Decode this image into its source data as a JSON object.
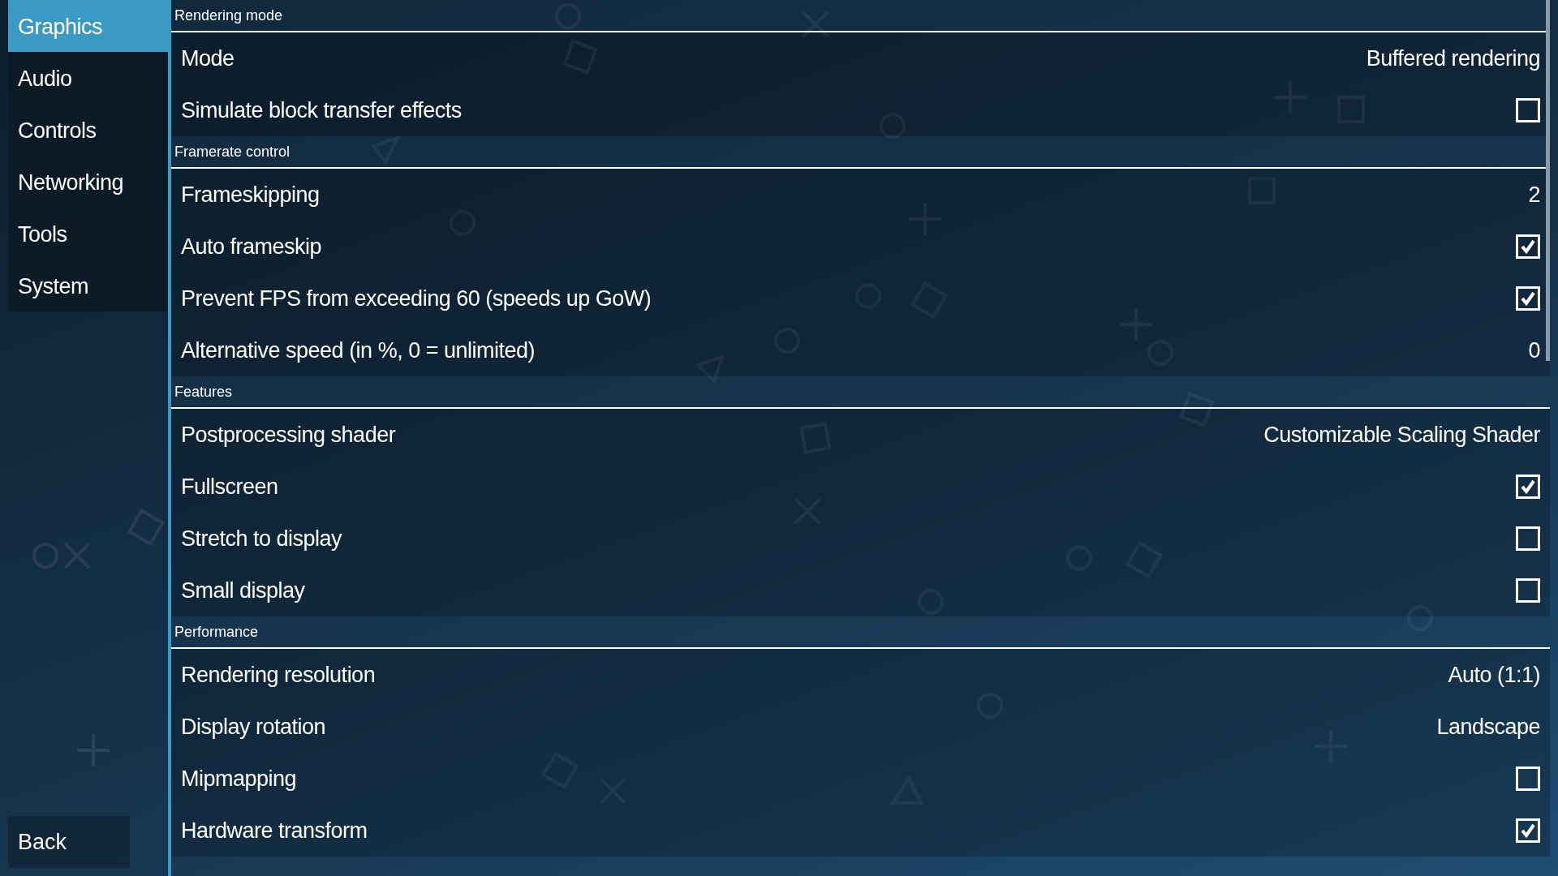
{
  "sidebar": {
    "items": [
      {
        "label": "Graphics",
        "selected": true
      },
      {
        "label": "Audio",
        "selected": false
      },
      {
        "label": "Controls",
        "selected": false
      },
      {
        "label": "Networking",
        "selected": false
      },
      {
        "label": "Tools",
        "selected": false
      },
      {
        "label": "System",
        "selected": false
      }
    ],
    "back_button": "Back"
  },
  "sections": [
    {
      "title": "Rendering mode",
      "rows": [
        {
          "kind": "value",
          "label": "Mode",
          "value": "Buffered rendering"
        },
        {
          "kind": "checkbox",
          "label": "Simulate block transfer effects",
          "checked": false
        }
      ]
    },
    {
      "title": "Framerate control",
      "rows": [
        {
          "kind": "value",
          "label": "Frameskipping",
          "value": "2"
        },
        {
          "kind": "checkbox",
          "label": "Auto frameskip",
          "checked": true
        },
        {
          "kind": "checkbox",
          "label": "Prevent FPS from exceeding 60 (speeds up GoW)",
          "checked": true
        },
        {
          "kind": "value",
          "label": "Alternative speed (in %, 0 = unlimited)",
          "value": "0"
        }
      ]
    },
    {
      "title": "Features",
      "rows": [
        {
          "kind": "value",
          "label": "Postprocessing shader",
          "value": "Customizable Scaling Shader"
        },
        {
          "kind": "checkbox",
          "label": "Fullscreen",
          "checked": true
        },
        {
          "kind": "checkbox",
          "label": "Stretch to display",
          "checked": false
        },
        {
          "kind": "checkbox",
          "label": "Small display",
          "checked": false
        }
      ]
    },
    {
      "title": "Performance",
      "rows": [
        {
          "kind": "value",
          "label": "Rendering resolution",
          "value": "Auto (1:1)"
        },
        {
          "kind": "value",
          "label": "Display rotation",
          "value": "Landscape"
        },
        {
          "kind": "checkbox",
          "label": "Mipmapping",
          "checked": false
        },
        {
          "kind": "checkbox",
          "label": "Hardware transform",
          "checked": true
        }
      ]
    }
  ]
}
